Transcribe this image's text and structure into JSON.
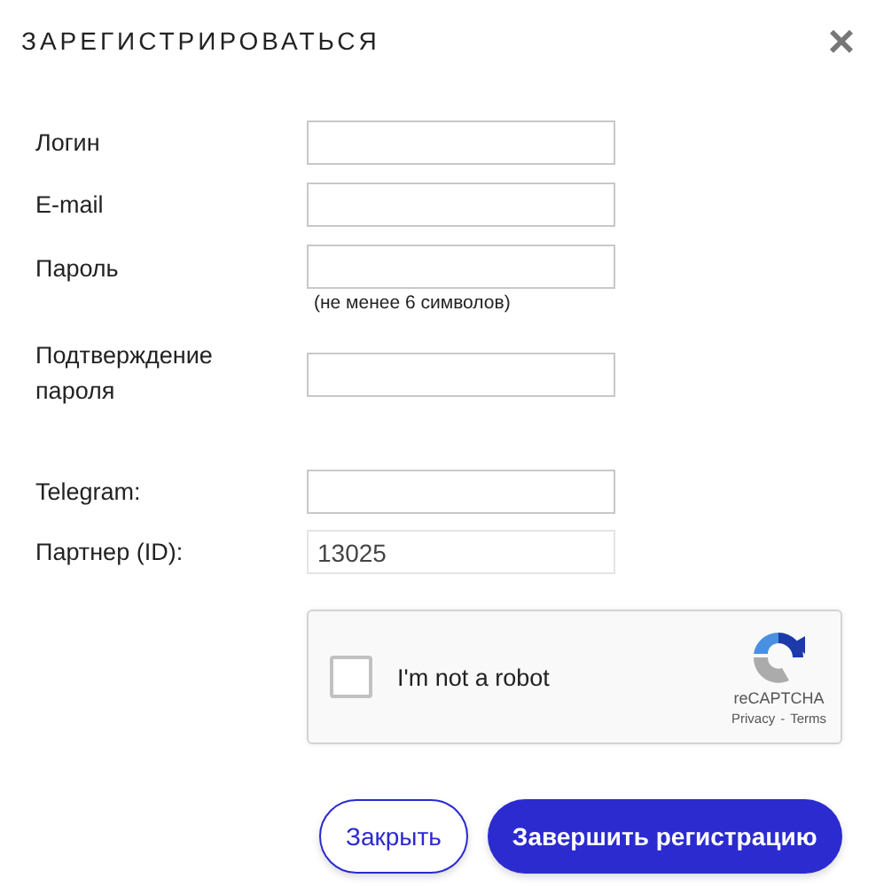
{
  "dialog": {
    "title": "ЗАРЕГИСТРИРОВАТЬСЯ",
    "close": "×"
  },
  "fields": [
    {
      "label": "Логин"
    },
    {
      "label": "E-mail"
    },
    {
      "label": "Пароль",
      "hint": "(не менее 6 символов)"
    },
    {
      "label": "Подтверждение пароля"
    },
    {
      "label": "Telegram:"
    },
    {
      "label": "Партнер (ID):",
      "value": "13025"
    }
  ],
  "captcha": {
    "checked": false,
    "text": "I'm not a robot",
    "brand": "reCAPTCHA",
    "privacy": "Privacy",
    "separator": "-",
    "terms": "Terms"
  },
  "buttons": [
    {
      "label": "Закрыть",
      "kind": "secondary"
    },
    {
      "label": "Завершить регистрацию",
      "kind": "primary"
    }
  ]
}
